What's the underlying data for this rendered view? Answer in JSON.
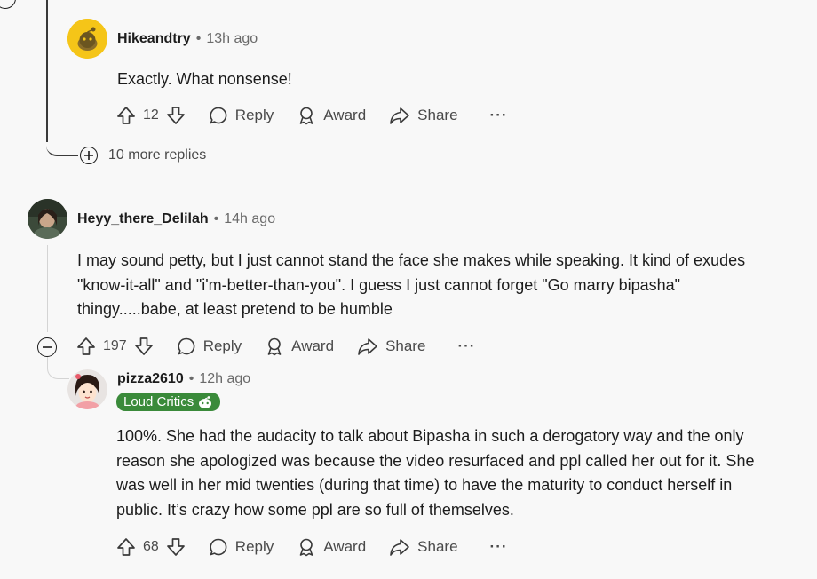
{
  "comments": [
    {
      "author": "Hikeandtry",
      "separator": "•",
      "time": "13h ago",
      "text": "Exactly. What nonsense!",
      "score": "12",
      "reply_label": "Reply",
      "award_label": "Award",
      "share_label": "Share",
      "more_label": "···",
      "avatar_color": "#f5c518"
    },
    {
      "author": "Heyy_there_Delilah",
      "separator": "•",
      "time": "14h ago",
      "text": "I may sound petty, but I just cannot stand the face she makes while speaking. It kind of exudes \"know-it-all\" and \"i'm-better-than-you\". I guess I just cannot forget \"Go marry bipasha\" thingy.....babe, at least pretend to be humble",
      "score": "197",
      "reply_label": "Reply",
      "award_label": "Award",
      "share_label": "Share",
      "more_label": "···"
    },
    {
      "author": "pizza2610",
      "separator": "•",
      "time": "12h ago",
      "flair": "Loud Critics",
      "text": "100%. She had the audacity to talk about Bipasha in such a derogatory way and the only reason she apologized was because the video resurfaced and ppl called her out for it. She was well in her mid twenties (during that time) to have the maturity to conduct herself in public. It’s crazy how some ppl are so full of themselves.",
      "score": "68",
      "reply_label": "Reply",
      "award_label": "Award",
      "share_label": "Share",
      "more_label": "···",
      "flair_color": "#3a8a3a"
    }
  ],
  "more_replies": "10 more replies"
}
